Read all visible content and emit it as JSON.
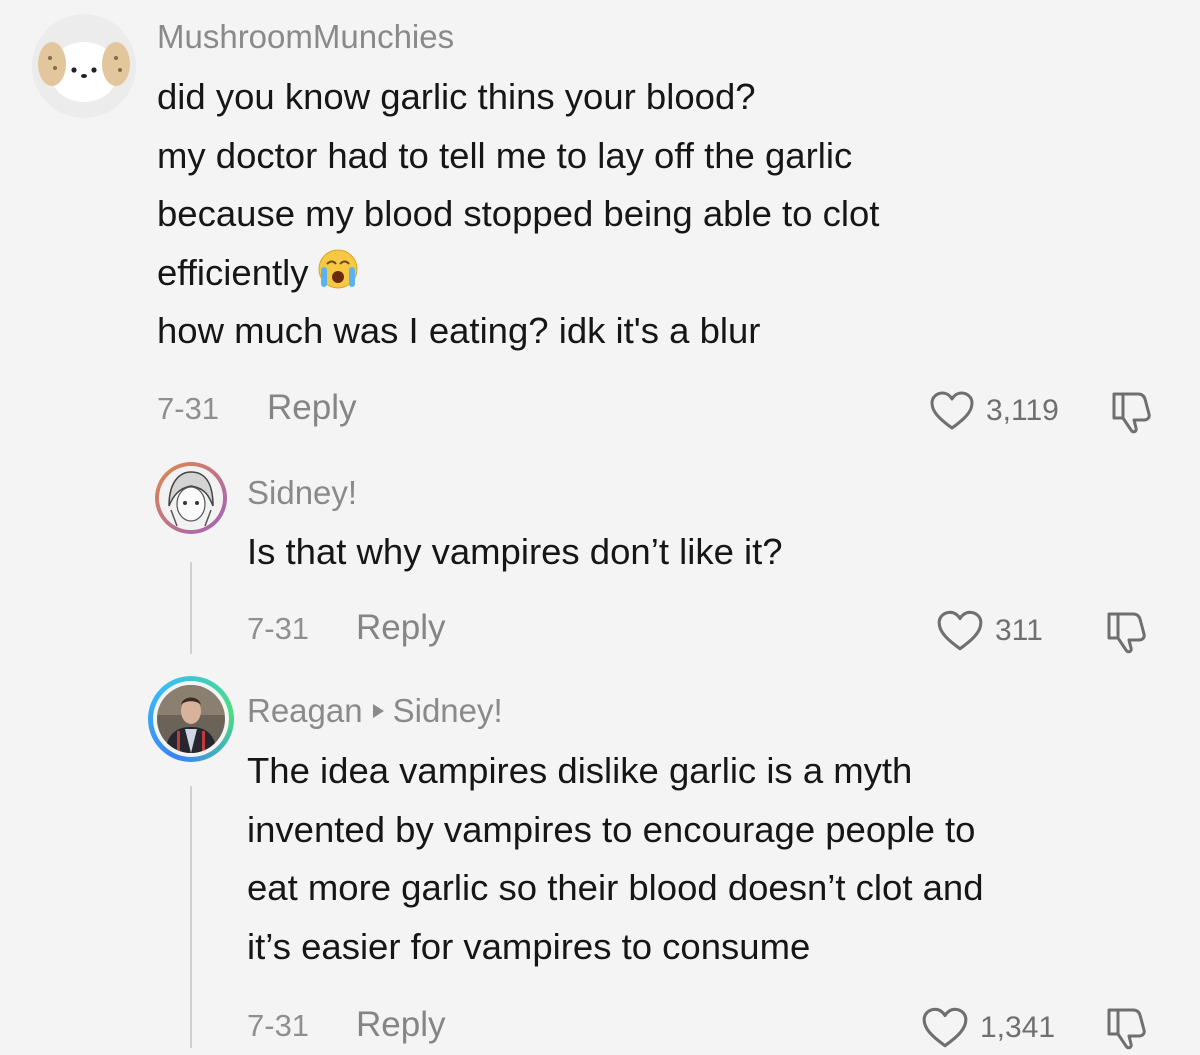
{
  "comments": [
    {
      "username": "MushroomMunchies",
      "lines": [
        "did you know garlic thins your blood?",
        "my doctor had to tell me to lay off the garlic",
        "because my blood stopped being able to clot",
        "efficiently",
        "how much was I eating? idk it's a blur"
      ],
      "emoji": "loudly-crying-face",
      "date": "7-31",
      "reply_label": "Reply",
      "likes": "3,119",
      "avatar_icon": "dog-plush-avatar"
    },
    {
      "username": "Sidney!",
      "lines": [
        "Is that why vampires don’t like it?"
      ],
      "date": "7-31",
      "reply_label": "Reply",
      "likes": "311",
      "avatar_icon": "anime-character-avatar"
    },
    {
      "username": "Reagan",
      "reply_to": "Sidney!",
      "lines": [
        "The idea vampires dislike garlic is a myth",
        "invented by vampires to encourage people to",
        "eat more garlic so their blood doesn’t clot and",
        "it’s easier for vampires to consume"
      ],
      "date": "7-31",
      "reply_label": "Reply",
      "likes": "1,341",
      "avatar_icon": "man-in-suit-avatar"
    }
  ],
  "colors": {
    "background": "#f4f4f4",
    "text": "#161616",
    "meta": "#8a8a8a",
    "avatar_ring_gradient": [
      "#3b82f6",
      "#4ade80"
    ]
  }
}
